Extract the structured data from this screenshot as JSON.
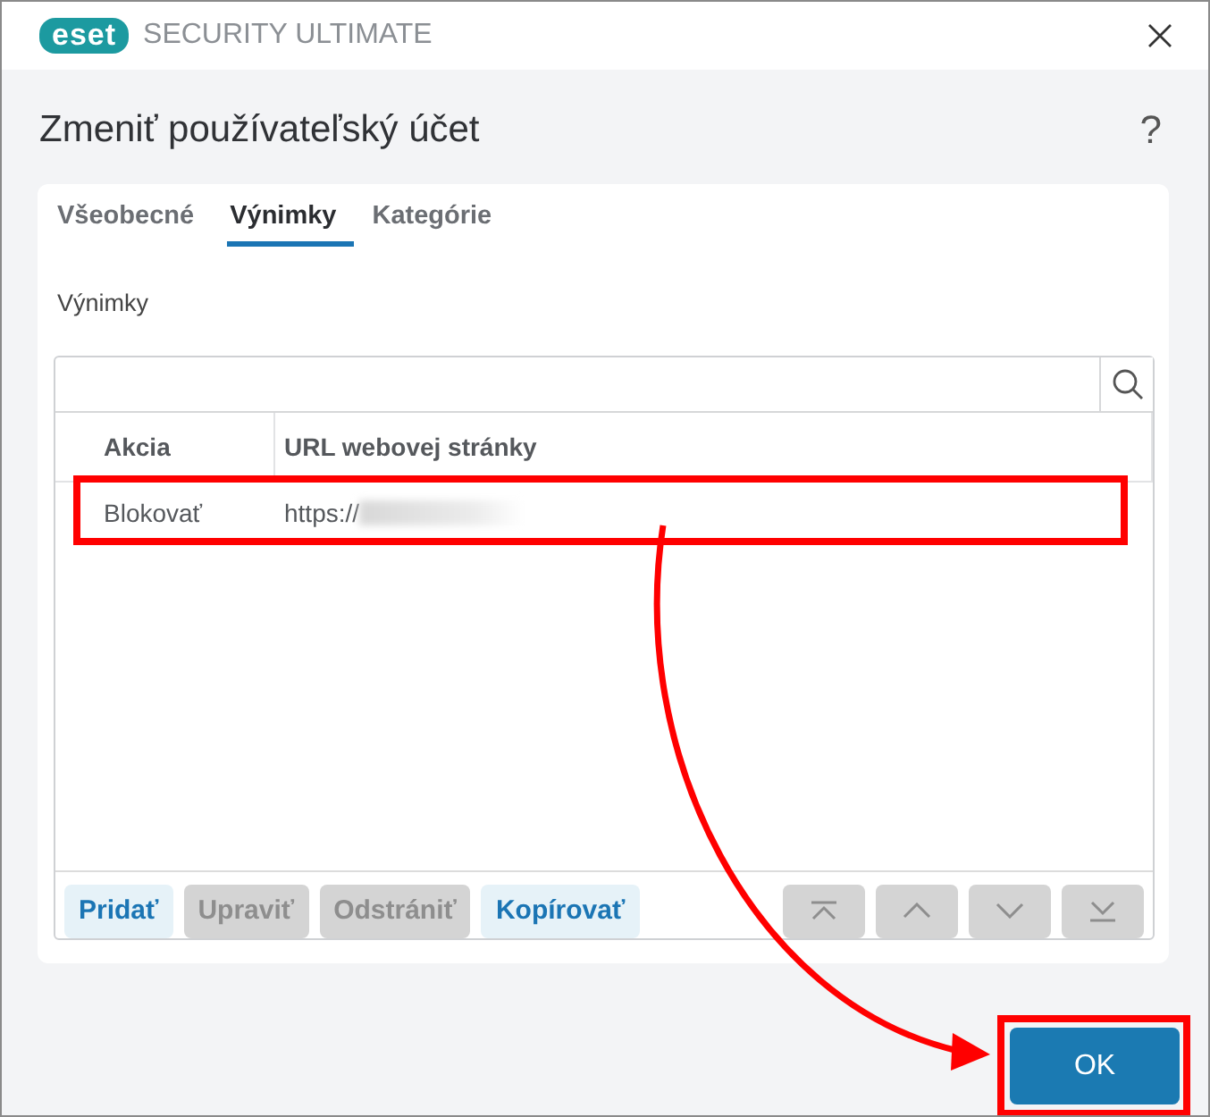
{
  "window": {
    "logo": "eset",
    "title": "SECURITY ULTIMATE"
  },
  "dialog": {
    "title": "Zmeniť používateľský účet",
    "help": "?"
  },
  "tabs": [
    {
      "label": "Všeobecné",
      "selected": false
    },
    {
      "label": "Výnimky",
      "selected": true
    },
    {
      "label": "Kategórie",
      "selected": false
    }
  ],
  "section_label": "Výnimky",
  "table": {
    "columns": [
      "Akcia",
      "URL webovej stránky"
    ],
    "rows": [
      {
        "action": "Blokovať",
        "url": "https://",
        "url_redacted": true,
        "highlighted": true
      }
    ]
  },
  "actions": [
    {
      "label": "Pridať",
      "disabled": false
    },
    {
      "label": "Upraviť",
      "disabled": true
    },
    {
      "label": "Odstrániť",
      "disabled": true
    },
    {
      "label": "Kopírovať",
      "disabled": false
    }
  ],
  "move_buttons": [
    {
      "kind": "top",
      "disabled": true
    },
    {
      "kind": "up",
      "disabled": true
    },
    {
      "kind": "down",
      "disabled": true
    },
    {
      "kind": "bottom",
      "disabled": true
    }
  ],
  "ok": {
    "label": "OK",
    "highlighted": true
  }
}
